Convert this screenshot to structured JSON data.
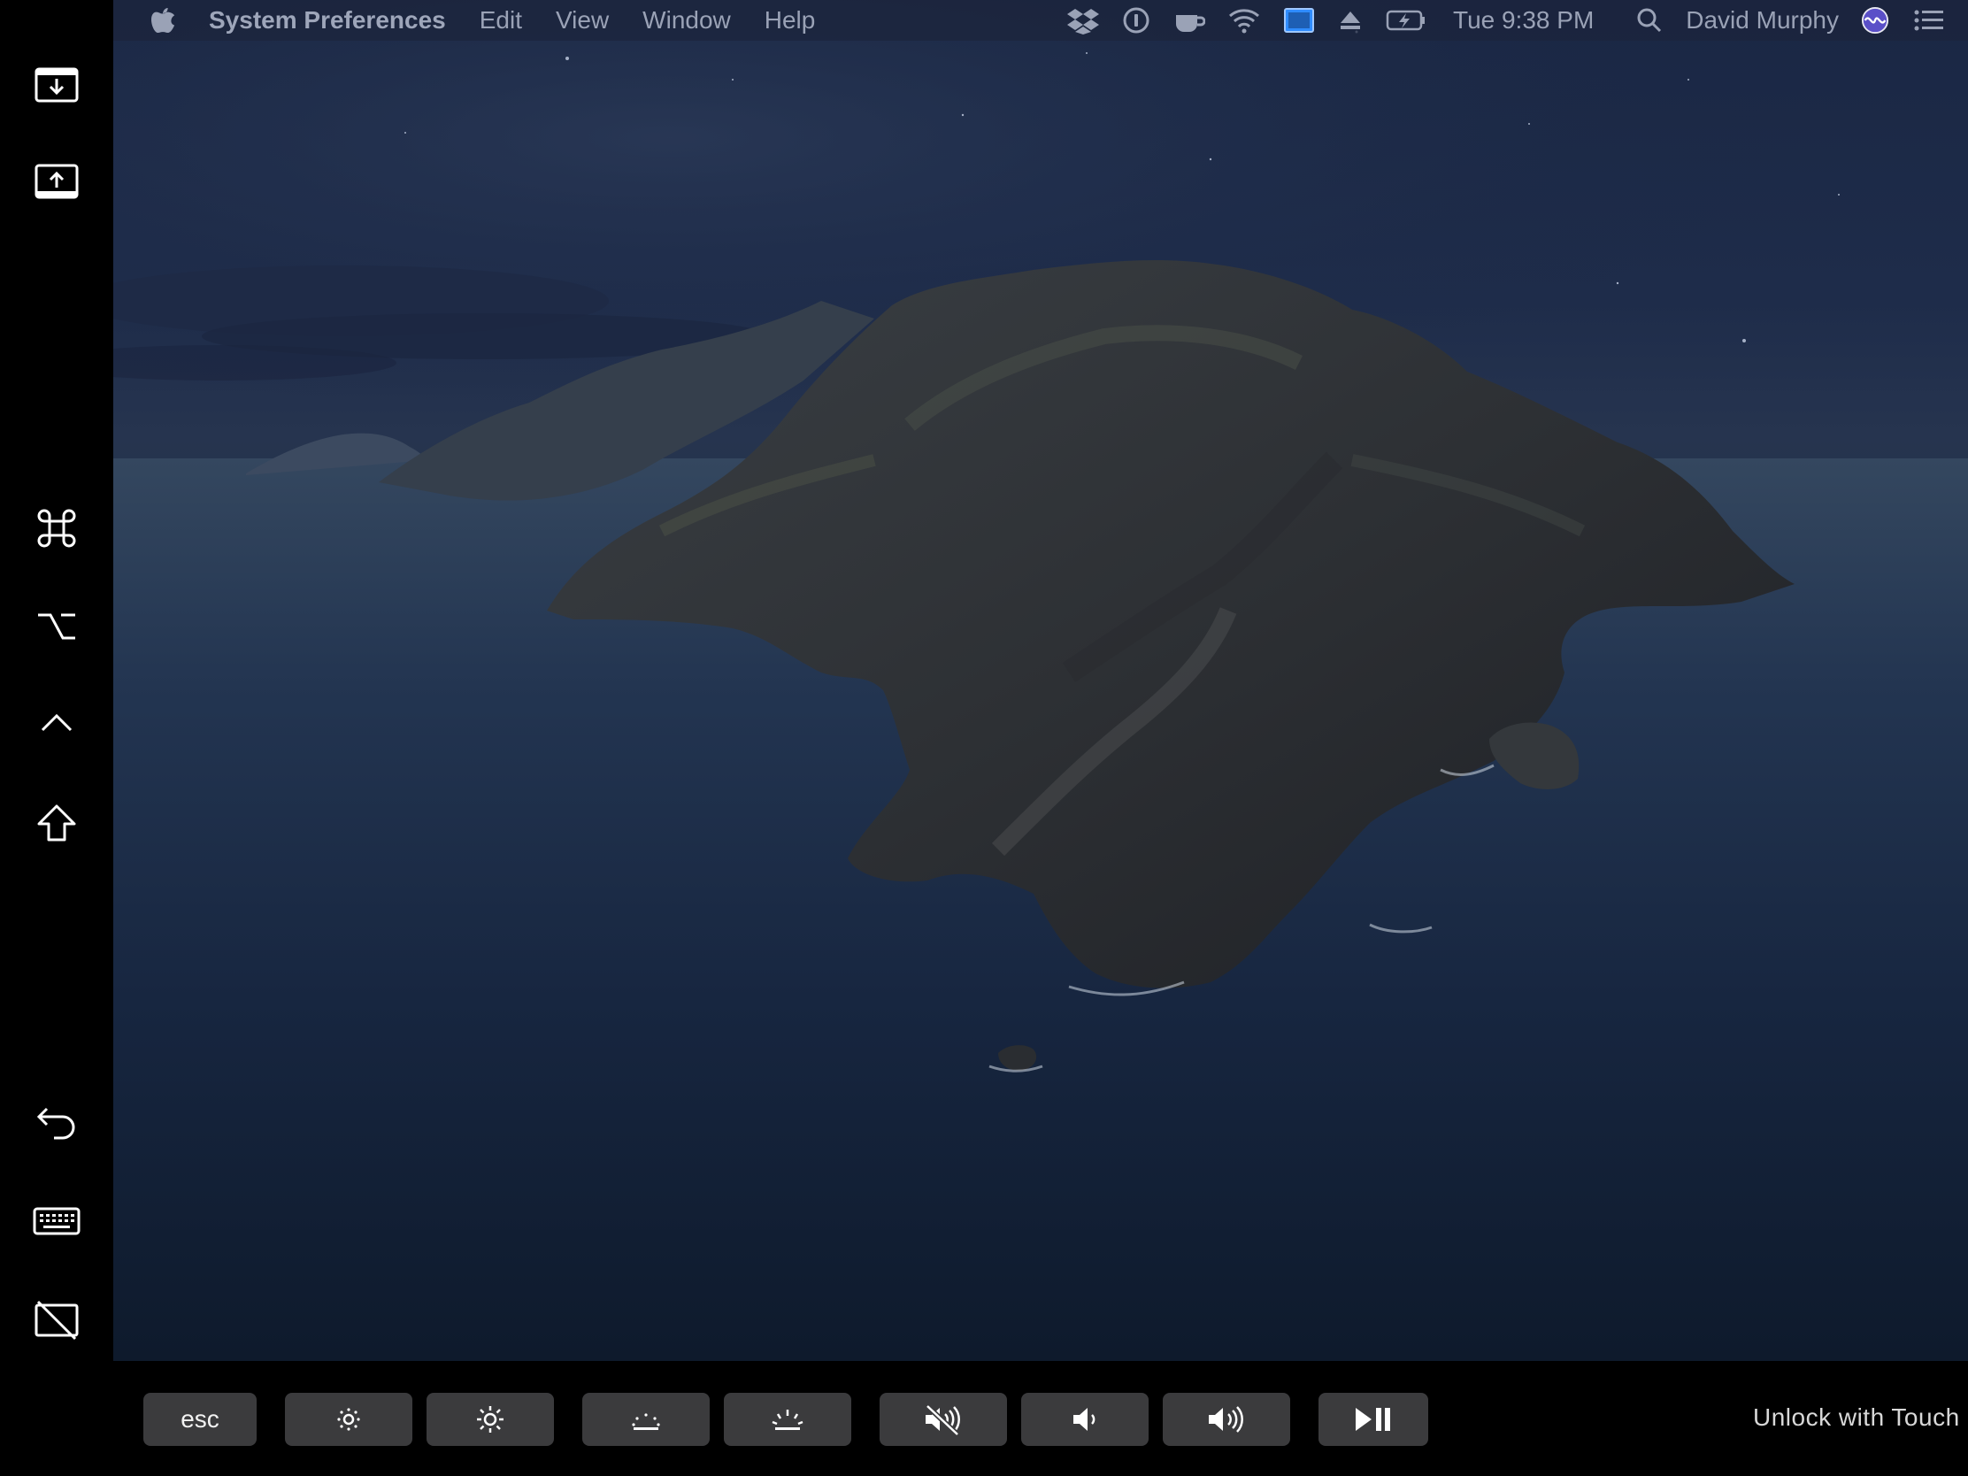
{
  "menubar": {
    "app_name": "System Preferences",
    "menus": [
      "Edit",
      "View",
      "Window",
      "Help"
    ],
    "clock": "Tue 9:38 PM",
    "user": "David Murphy",
    "status_icons": [
      "dropbox-icon",
      "onepassword-icon",
      "amphetamine-icon",
      "wifi-icon",
      "sidecar-display-icon",
      "eject-icon",
      "battery-charging-icon",
      "spotlight-search-icon",
      "siri-icon",
      "notification-center-icon"
    ]
  },
  "sidebar": {
    "items": [
      {
        "name": "hide-menu-bar-button",
        "icon": "screen-down-arrow-icon"
      },
      {
        "name": "show-dock-button",
        "icon": "screen-up-arrow-icon"
      },
      {
        "name": "command-key-button",
        "icon": "command-icon"
      },
      {
        "name": "option-key-button",
        "icon": "option-icon"
      },
      {
        "name": "control-key-button",
        "icon": "control-caret-icon"
      },
      {
        "name": "shift-key-button",
        "icon": "shift-arrow-icon"
      },
      {
        "name": "undo-button",
        "icon": "undo-arrow-icon"
      },
      {
        "name": "show-keyboard-button",
        "icon": "keyboard-icon"
      },
      {
        "name": "disconnect-sidecar-button",
        "icon": "display-off-icon"
      }
    ]
  },
  "touchbar": {
    "esc_label": "esc",
    "keys": [
      "brightness-down-icon",
      "brightness-up-icon",
      "keyboard-backlight-down-icon",
      "keyboard-backlight-up-icon",
      "mute-icon",
      "volume-down-icon",
      "volume-up-icon",
      "play-pause-icon"
    ],
    "unlock_text": "Unlock with Touch"
  },
  "colors": {
    "menubar_text": "#9aa2b6",
    "touchbar_key": "#3b3b3d",
    "sidecar_active": "#2f8cff"
  }
}
